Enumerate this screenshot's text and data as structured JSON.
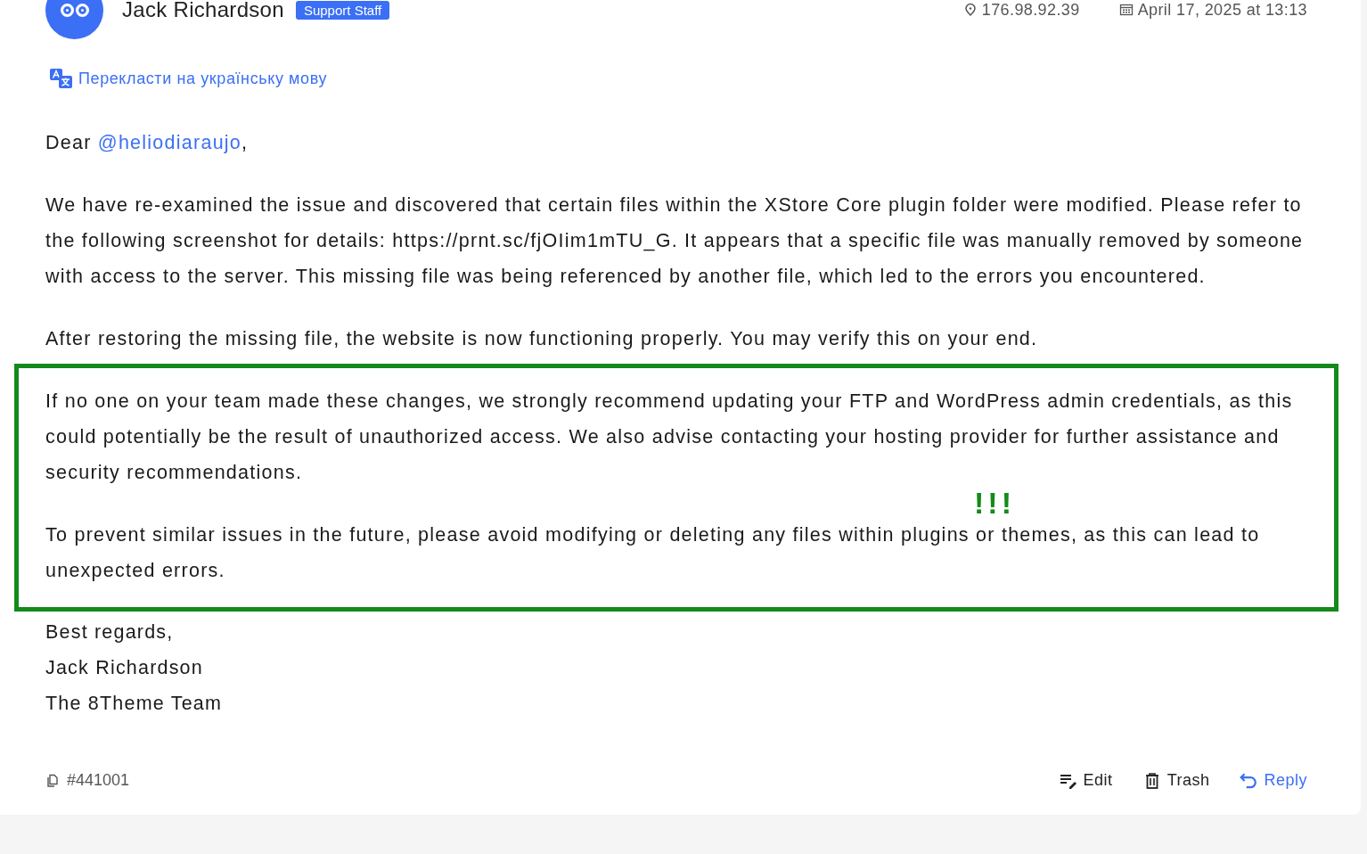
{
  "author": {
    "name": "Jack Richardson",
    "badge": "Support Staff",
    "ip": "176.98.92.39",
    "date": "April 17, 2025 at 13:13"
  },
  "translate_link": "Перекласти на українську мову",
  "body": [
    {
      "kind": "greeting",
      "prefix": "Dear",
      "mention": "@heliodiaraujo",
      "suffix": ","
    },
    {
      "kind": "paragraph",
      "text": "We have re-examined the issue and discovered that certain files within the XStore Core plugin folder were modified. Please refer to the following screenshot for details: https://prnt.sc/fjOIim1mTU_G. It appears that a specific file was manually removed by someone with access to the server. This missing file was being referenced by another file, which led to the errors you encountered."
    },
    {
      "kind": "paragraph",
      "text": "After restoring the missing file, the website is now functioning properly. You may verify this on your end."
    },
    {
      "kind": "highlight",
      "note": "!!!",
      "paragraphs": [
        "If no one on your team made these changes, we strongly recommend updating your FTP and WordPress admin credentials, as this could potentially be the result of unauthorized access. We also advise contacting your hosting provider for further assistance and security recommendations.",
        "To prevent similar issues in the future, please avoid modifying or deleting any files within plugins or themes, as this can lead to unexpected errors."
      ]
    }
  ],
  "signature": [
    "Best regards,",
    "Jack Richardson",
    "The 8Theme Team"
  ],
  "footer": {
    "id": "#441001",
    "actions": [
      {
        "kind": "edit",
        "label": "Edit"
      },
      {
        "kind": "trash",
        "label": "Trash"
      },
      {
        "kind": "reply",
        "label": "Reply"
      }
    ]
  }
}
